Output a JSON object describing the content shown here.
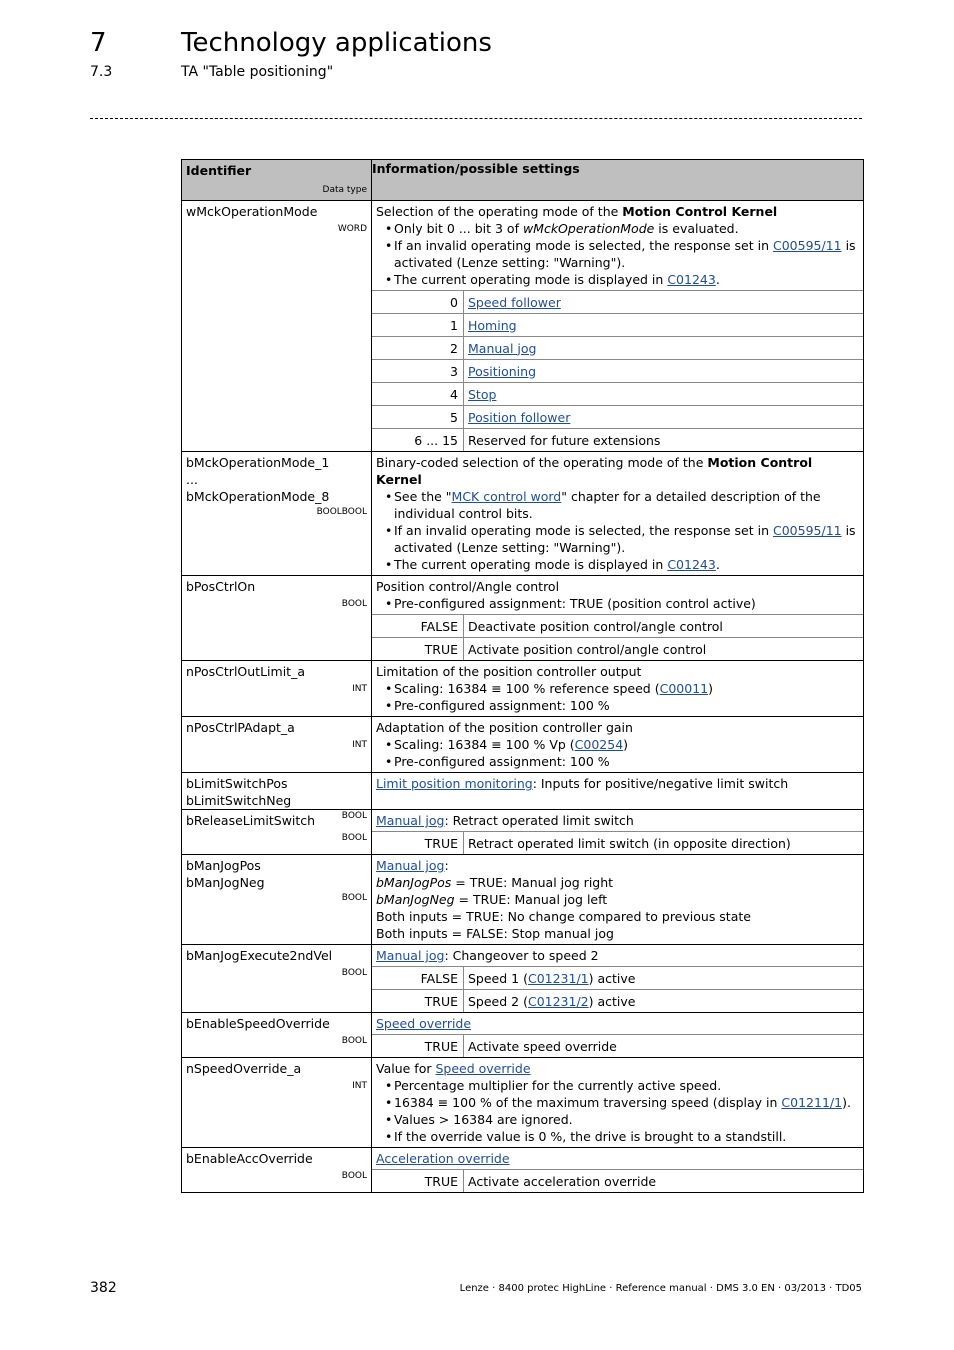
{
  "header": {
    "chapter_number": "7",
    "chapter_title": "Technology applications",
    "section_number": "7.3",
    "section_title": "TA \"Table positioning\""
  },
  "table": {
    "col_identifier": "Identifier",
    "col_data_type": "Data type",
    "col_info": "Information/possible settings",
    "rows": [
      {
        "id_lines": [
          "wMckOperationMode"
        ],
        "type": "WORD",
        "intro": [
          "Selection of the operating mode of the ",
          "Motion Control Kernel"
        ],
        "bullets": [
          [
            "Only bit 0 ... bit 3 of ",
            "wMckOperationMode",
            " is evaluated."
          ],
          [
            "If an invalid operating mode is selected, the response set in ",
            "C00595/11",
            " is activated (Lenze setting: \"Warning\")."
          ],
          [
            "The current operating mode is displayed in ",
            "C01243",
            "."
          ]
        ],
        "values": [
          {
            "v": "0",
            "d": "Speed follower",
            "link": true
          },
          {
            "v": "1",
            "d": "Homing",
            "link": true
          },
          {
            "v": "2",
            "d": "Manual jog",
            "link": true
          },
          {
            "v": "3",
            "d": "Positioning",
            "link": true
          },
          {
            "v": "4",
            "d": "Stop",
            "link": true
          },
          {
            "v": "5",
            "d": "Position follower",
            "link": true
          },
          {
            "v": "6 ... 15",
            "d": "Reserved for future extensions",
            "link": false
          }
        ]
      },
      {
        "id_lines": [
          "bMckOperationMode_1",
          "...",
          "bMckOperationMode_8"
        ],
        "type": "BOOLBOOL",
        "intro": [
          "Binary-coded selection of the operating mode of the ",
          "Motion Control Kernel"
        ],
        "bullets": [
          [
            "See the \"",
            "MCK control word",
            "\" chapter for a detailed description of the individual control bits."
          ],
          [
            "If an invalid operating mode is selected, the response set in ",
            "C00595/11",
            " is activated (Lenze setting: \"Warning\")."
          ],
          [
            "The current operating mode is displayed in ",
            "C01243",
            "."
          ]
        ]
      },
      {
        "id_lines": [
          "bPosCtrlOn"
        ],
        "type": "BOOL",
        "intro_plain": "Position control/Angle control",
        "bullets_plain": [
          "Pre-configured assignment: TRUE (position control active)"
        ],
        "values": [
          {
            "v": "FALSE",
            "d": "Deactivate position control/angle control"
          },
          {
            "v": "TRUE",
            "d": "Activate position control/angle control"
          }
        ]
      },
      {
        "id_lines": [
          "nPosCtrlOutLimit_a"
        ],
        "type": "INT",
        "intro_plain": "Limitation of the position controller output",
        "bullets": [
          [
            "Scaling: 16384 ≡ 100 % reference speed (",
            "C00011",
            ")"
          ],
          [
            "Pre-configured assignment: 100 %",
            "",
            ""
          ]
        ]
      },
      {
        "id_lines": [
          "nPosCtrlPAdapt_a"
        ],
        "type": "INT",
        "intro_plain": "Adaptation of the position controller gain",
        "bullets": [
          [
            "Scaling: 16384 ≡ 100 % Vp (",
            "C00254",
            ")"
          ],
          [
            "Pre-configured assignment: 100 %",
            "",
            ""
          ]
        ]
      },
      {
        "id_lines": [
          "bLimitSwitchPos",
          "bLimitSwitchNeg"
        ],
        "type": "BOOL",
        "link_intro": [
          "Limit position monitoring",
          ": Inputs for positive/negative limit switch"
        ]
      },
      {
        "id_lines": [
          "bReleaseLimitSwitch"
        ],
        "type": "BOOL",
        "link_intro": [
          "Manual jog",
          ": Retract operated limit switch"
        ],
        "values": [
          {
            "v": "TRUE",
            "d": "Retract operated limit switch (in opposite direction)"
          }
        ]
      },
      {
        "id_lines": [
          "bManJogPos",
          "bManJogNeg"
        ],
        "type": "BOOL",
        "link_intro": [
          "Manual jog",
          ":"
        ],
        "lines": [
          [
            "bManJogPos",
            " = TRUE: Manual jog right"
          ],
          [
            "bManJogNeg",
            " = TRUE: Manual jog left"
          ],
          [
            "",
            "Both inputs = TRUE: No change compared to previous state"
          ],
          [
            "",
            "Both inputs = FALSE: Stop manual jog"
          ]
        ]
      },
      {
        "id_lines": [
          "bManJogExecute2ndVel"
        ],
        "type": "BOOL",
        "link_intro": [
          "Manual jog",
          ": Changeover to speed 2"
        ],
        "values": [
          {
            "v": "FALSE",
            "d_pre": "Speed 1 (",
            "d_link": "C01231/1",
            "d_post": ") active"
          },
          {
            "v": "TRUE",
            "d_pre": "Speed 2 (",
            "d_link": "C01231/2",
            "d_post": ") active"
          }
        ]
      },
      {
        "id_lines": [
          "bEnableSpeedOverride"
        ],
        "type": "BOOL",
        "link_intro": [
          "Speed override",
          ""
        ],
        "values": [
          {
            "v": "TRUE",
            "d": "Activate speed override"
          }
        ]
      },
      {
        "id_lines": [
          "nSpeedOverride_a"
        ],
        "type": "INT",
        "intro_mixed": [
          "Value for ",
          "Speed override"
        ],
        "bullets": [
          [
            "Percentage multiplier for the currently active speed.",
            "",
            ""
          ],
          [
            "16384 ≡ 100 % of the maximum traversing speed (display in ",
            "C01211/1",
            ")."
          ],
          [
            "Values > 16384 are ignored.",
            "",
            ""
          ],
          [
            "If the override value is 0 %, the drive is brought to a standstill.",
            "",
            ""
          ]
        ]
      },
      {
        "id_lines": [
          "bEnableAccOverride"
        ],
        "type": "BOOL",
        "link_intro": [
          "Acceleration override",
          ""
        ],
        "values": [
          {
            "v": "TRUE",
            "d": "Activate acceleration override"
          }
        ]
      }
    ]
  },
  "footer": {
    "page_number": "382",
    "doc_info": "Lenze · 8400 protec HighLine · Reference manual · DMS 3.0 EN · 03/2013 · TD05"
  },
  "colors": {
    "link": "#1f4e96",
    "header_bg": "#bfbfbf"
  }
}
